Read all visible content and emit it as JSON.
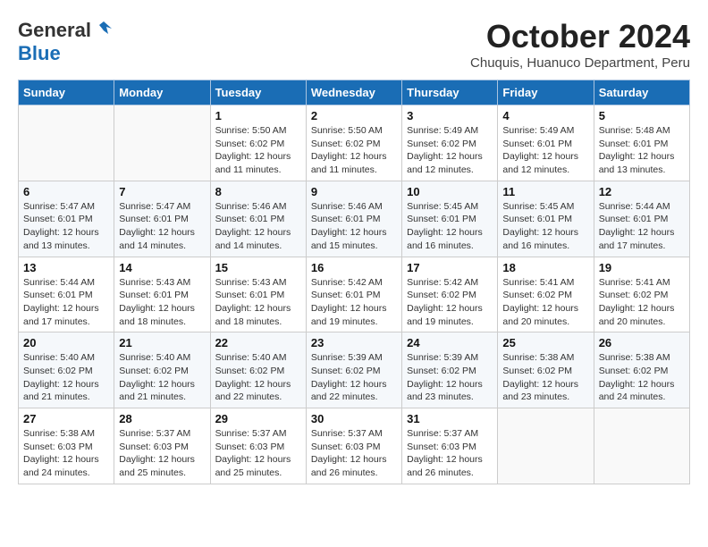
{
  "header": {
    "logo_general": "General",
    "logo_blue": "Blue",
    "month_title": "October 2024",
    "location": "Chuquis, Huanuco Department, Peru"
  },
  "days_of_week": [
    "Sunday",
    "Monday",
    "Tuesday",
    "Wednesday",
    "Thursday",
    "Friday",
    "Saturday"
  ],
  "weeks": [
    [
      {
        "day": "",
        "info": ""
      },
      {
        "day": "",
        "info": ""
      },
      {
        "day": "1",
        "sunrise": "Sunrise: 5:50 AM",
        "sunset": "Sunset: 6:02 PM",
        "daylight": "Daylight: 12 hours and 11 minutes."
      },
      {
        "day": "2",
        "sunrise": "Sunrise: 5:50 AM",
        "sunset": "Sunset: 6:02 PM",
        "daylight": "Daylight: 12 hours and 11 minutes."
      },
      {
        "day": "3",
        "sunrise": "Sunrise: 5:49 AM",
        "sunset": "Sunset: 6:02 PM",
        "daylight": "Daylight: 12 hours and 12 minutes."
      },
      {
        "day": "4",
        "sunrise": "Sunrise: 5:49 AM",
        "sunset": "Sunset: 6:01 PM",
        "daylight": "Daylight: 12 hours and 12 minutes."
      },
      {
        "day": "5",
        "sunrise": "Sunrise: 5:48 AM",
        "sunset": "Sunset: 6:01 PM",
        "daylight": "Daylight: 12 hours and 13 minutes."
      }
    ],
    [
      {
        "day": "6",
        "sunrise": "Sunrise: 5:47 AM",
        "sunset": "Sunset: 6:01 PM",
        "daylight": "Daylight: 12 hours and 13 minutes."
      },
      {
        "day": "7",
        "sunrise": "Sunrise: 5:47 AM",
        "sunset": "Sunset: 6:01 PM",
        "daylight": "Daylight: 12 hours and 14 minutes."
      },
      {
        "day": "8",
        "sunrise": "Sunrise: 5:46 AM",
        "sunset": "Sunset: 6:01 PM",
        "daylight": "Daylight: 12 hours and 14 minutes."
      },
      {
        "day": "9",
        "sunrise": "Sunrise: 5:46 AM",
        "sunset": "Sunset: 6:01 PM",
        "daylight": "Daylight: 12 hours and 15 minutes."
      },
      {
        "day": "10",
        "sunrise": "Sunrise: 5:45 AM",
        "sunset": "Sunset: 6:01 PM",
        "daylight": "Daylight: 12 hours and 16 minutes."
      },
      {
        "day": "11",
        "sunrise": "Sunrise: 5:45 AM",
        "sunset": "Sunset: 6:01 PM",
        "daylight": "Daylight: 12 hours and 16 minutes."
      },
      {
        "day": "12",
        "sunrise": "Sunrise: 5:44 AM",
        "sunset": "Sunset: 6:01 PM",
        "daylight": "Daylight: 12 hours and 17 minutes."
      }
    ],
    [
      {
        "day": "13",
        "sunrise": "Sunrise: 5:44 AM",
        "sunset": "Sunset: 6:01 PM",
        "daylight": "Daylight: 12 hours and 17 minutes."
      },
      {
        "day": "14",
        "sunrise": "Sunrise: 5:43 AM",
        "sunset": "Sunset: 6:01 PM",
        "daylight": "Daylight: 12 hours and 18 minutes."
      },
      {
        "day": "15",
        "sunrise": "Sunrise: 5:43 AM",
        "sunset": "Sunset: 6:01 PM",
        "daylight": "Daylight: 12 hours and 18 minutes."
      },
      {
        "day": "16",
        "sunrise": "Sunrise: 5:42 AM",
        "sunset": "Sunset: 6:01 PM",
        "daylight": "Daylight: 12 hours and 19 minutes."
      },
      {
        "day": "17",
        "sunrise": "Sunrise: 5:42 AM",
        "sunset": "Sunset: 6:02 PM",
        "daylight": "Daylight: 12 hours and 19 minutes."
      },
      {
        "day": "18",
        "sunrise": "Sunrise: 5:41 AM",
        "sunset": "Sunset: 6:02 PM",
        "daylight": "Daylight: 12 hours and 20 minutes."
      },
      {
        "day": "19",
        "sunrise": "Sunrise: 5:41 AM",
        "sunset": "Sunset: 6:02 PM",
        "daylight": "Daylight: 12 hours and 20 minutes."
      }
    ],
    [
      {
        "day": "20",
        "sunrise": "Sunrise: 5:40 AM",
        "sunset": "Sunset: 6:02 PM",
        "daylight": "Daylight: 12 hours and 21 minutes."
      },
      {
        "day": "21",
        "sunrise": "Sunrise: 5:40 AM",
        "sunset": "Sunset: 6:02 PM",
        "daylight": "Daylight: 12 hours and 21 minutes."
      },
      {
        "day": "22",
        "sunrise": "Sunrise: 5:40 AM",
        "sunset": "Sunset: 6:02 PM",
        "daylight": "Daylight: 12 hours and 22 minutes."
      },
      {
        "day": "23",
        "sunrise": "Sunrise: 5:39 AM",
        "sunset": "Sunset: 6:02 PM",
        "daylight": "Daylight: 12 hours and 22 minutes."
      },
      {
        "day": "24",
        "sunrise": "Sunrise: 5:39 AM",
        "sunset": "Sunset: 6:02 PM",
        "daylight": "Daylight: 12 hours and 23 minutes."
      },
      {
        "day": "25",
        "sunrise": "Sunrise: 5:38 AM",
        "sunset": "Sunset: 6:02 PM",
        "daylight": "Daylight: 12 hours and 23 minutes."
      },
      {
        "day": "26",
        "sunrise": "Sunrise: 5:38 AM",
        "sunset": "Sunset: 6:02 PM",
        "daylight": "Daylight: 12 hours and 24 minutes."
      }
    ],
    [
      {
        "day": "27",
        "sunrise": "Sunrise: 5:38 AM",
        "sunset": "Sunset: 6:03 PM",
        "daylight": "Daylight: 12 hours and 24 minutes."
      },
      {
        "day": "28",
        "sunrise": "Sunrise: 5:37 AM",
        "sunset": "Sunset: 6:03 PM",
        "daylight": "Daylight: 12 hours and 25 minutes."
      },
      {
        "day": "29",
        "sunrise": "Sunrise: 5:37 AM",
        "sunset": "Sunset: 6:03 PM",
        "daylight": "Daylight: 12 hours and 25 minutes."
      },
      {
        "day": "30",
        "sunrise": "Sunrise: 5:37 AM",
        "sunset": "Sunset: 6:03 PM",
        "daylight": "Daylight: 12 hours and 26 minutes."
      },
      {
        "day": "31",
        "sunrise": "Sunrise: 5:37 AM",
        "sunset": "Sunset: 6:03 PM",
        "daylight": "Daylight: 12 hours and 26 minutes."
      },
      {
        "day": "",
        "info": ""
      },
      {
        "day": "",
        "info": ""
      }
    ]
  ]
}
